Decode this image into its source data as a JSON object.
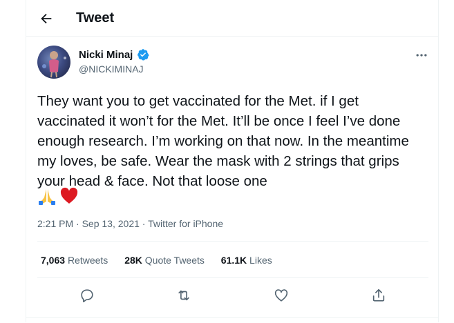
{
  "header": {
    "title": "Tweet"
  },
  "author": {
    "name": "Nicki Minaj",
    "handle": "@NICKIMINAJ"
  },
  "tweet": {
    "text": "They want you to get vaccinated for the Met. if I get vaccinated it won’t for the Met. It’ll be once I feel I’ve done enough research. I’m working on that now. In the meantime my loves, be safe. Wear the mask with 2 strings that grips your head & face. Not that loose one",
    "time": "2:21 PM",
    "separator": " · ",
    "date": "Sep 13, 2021",
    "source": "Twitter for iPhone"
  },
  "stats": {
    "retweets_count": "7,063",
    "retweets_label": "Retweets",
    "quotes_count": "28K",
    "quotes_label": "Quote Tweets",
    "likes_count": "61.1K",
    "likes_label": "Likes"
  },
  "colors": {
    "verified": "#1d9bf0",
    "muted": "#536471",
    "border": "#eff3f4"
  }
}
